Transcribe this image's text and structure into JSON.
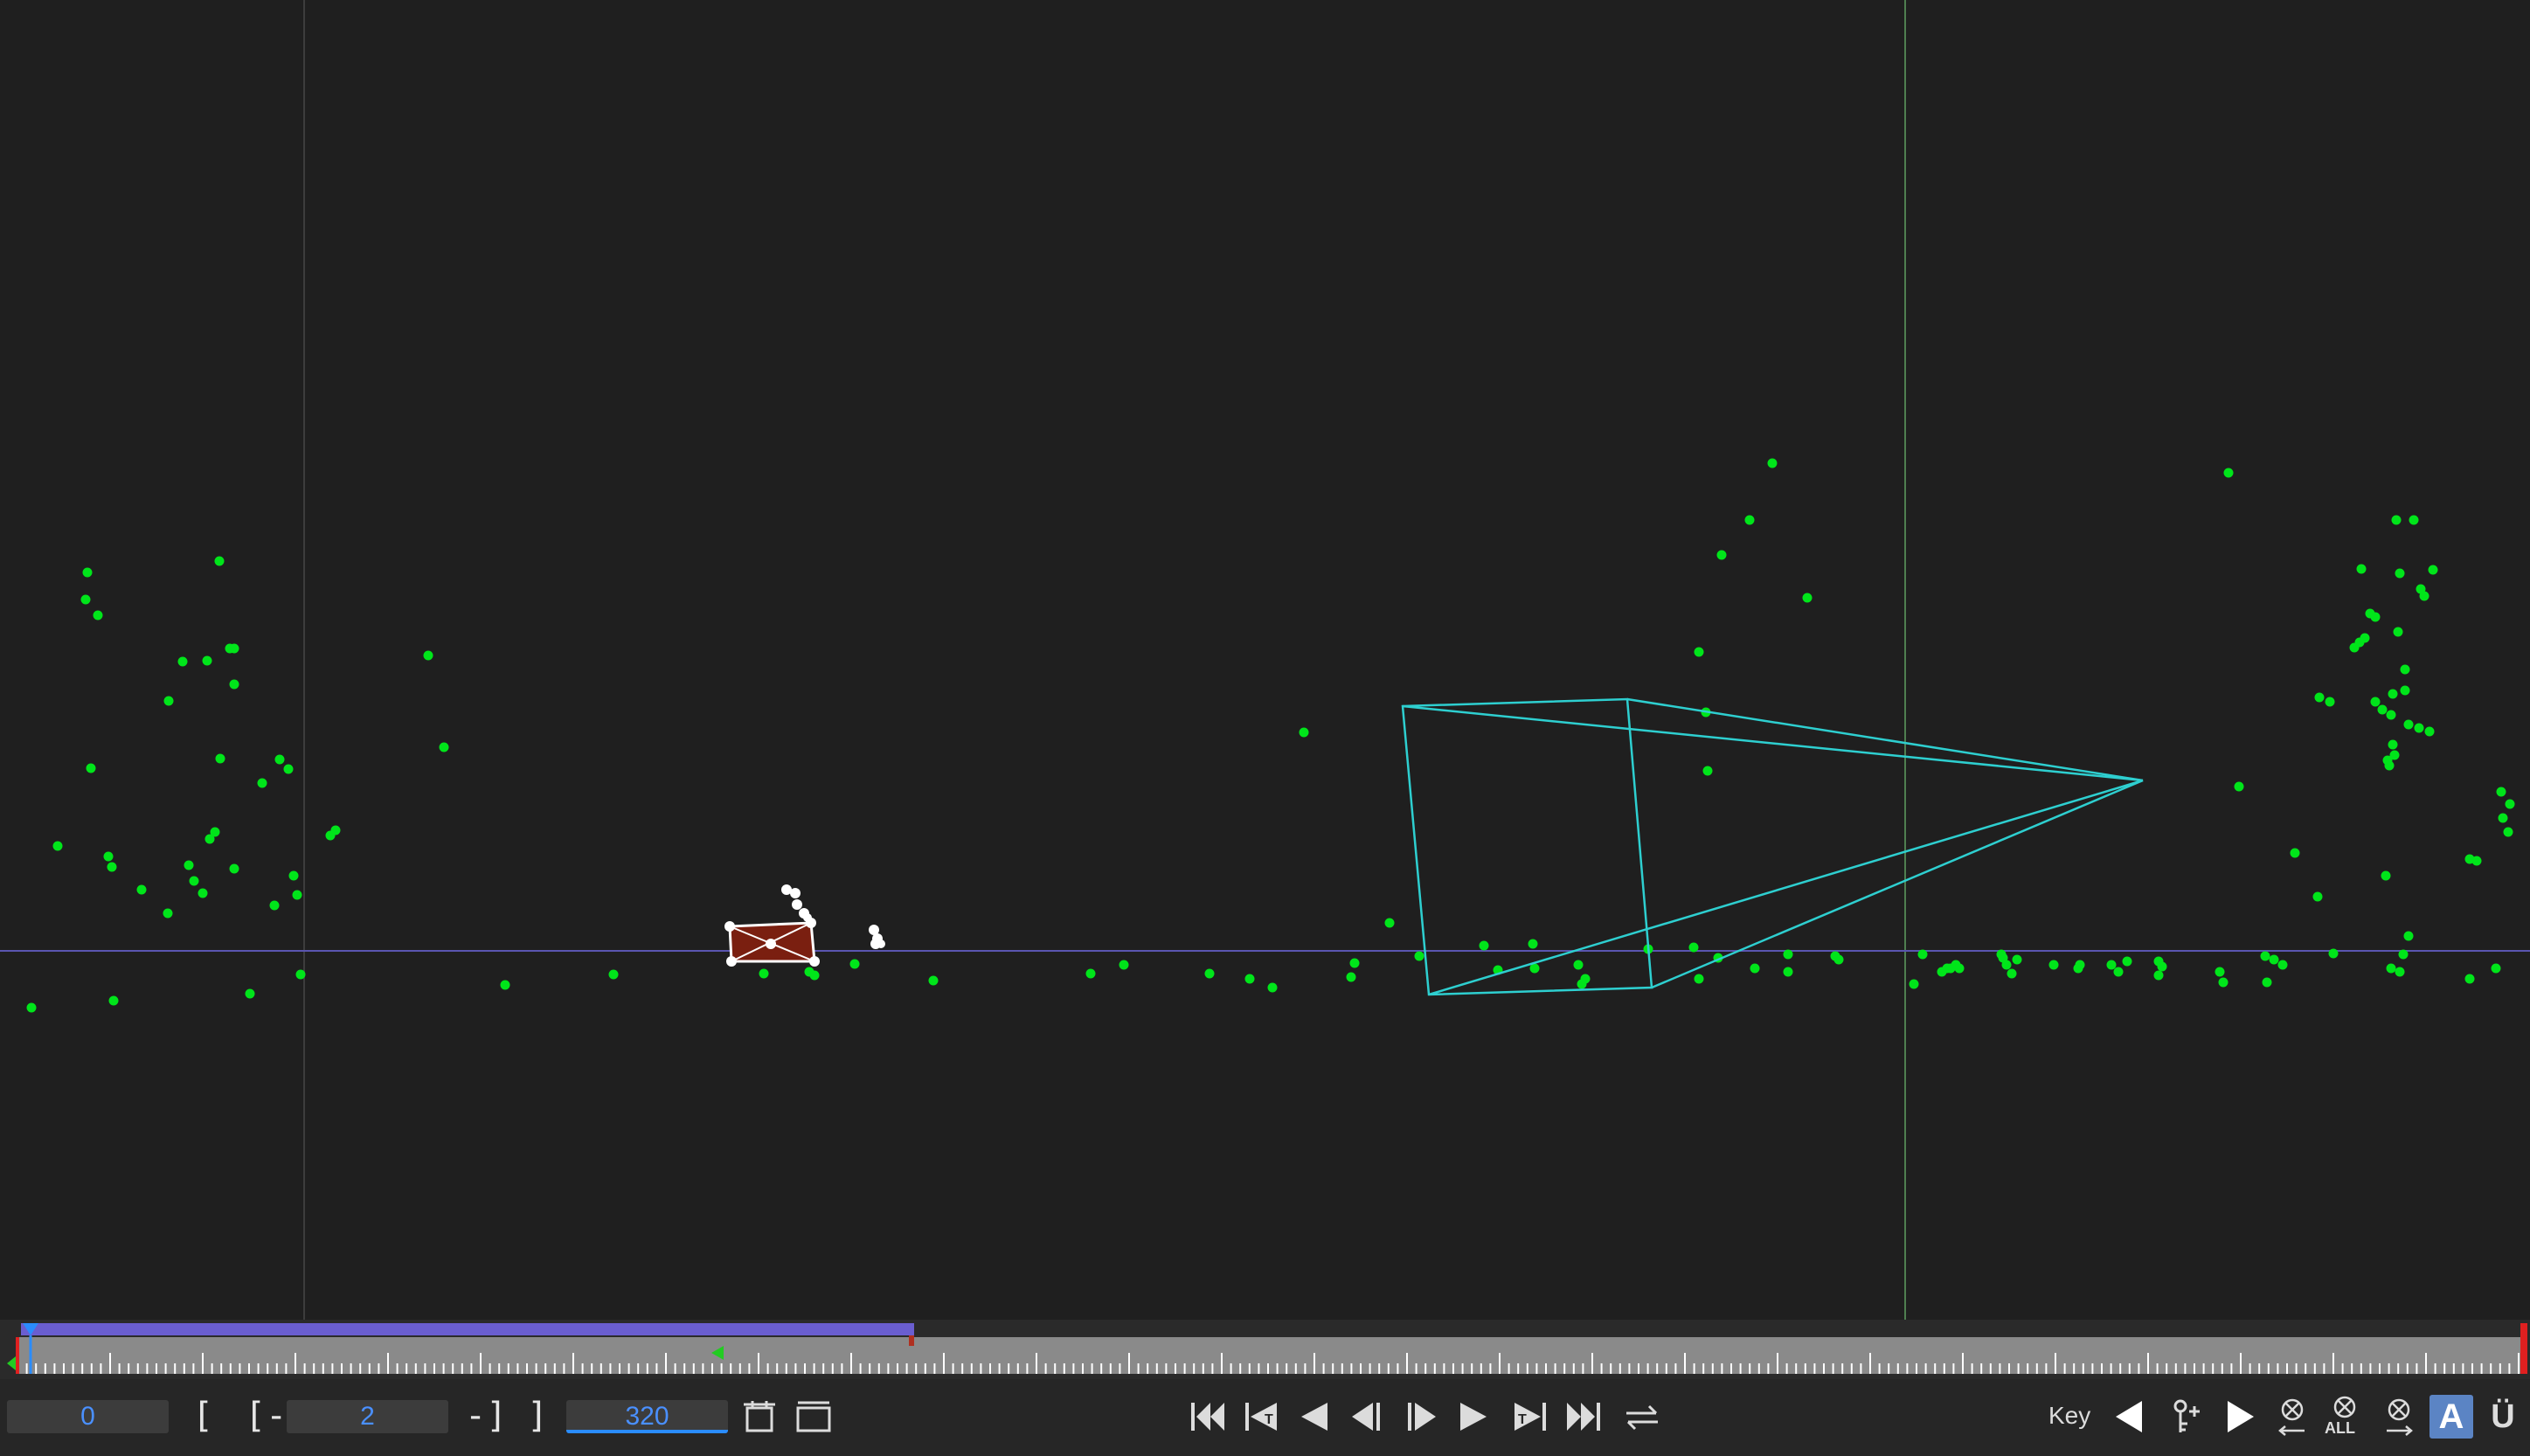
{
  "viewport": {
    "background": "#1f1f1f",
    "point_color": "#00e51a",
    "camera_color": "#2ecfd0",
    "ground_line_color": "#5a55b0",
    "selected_object_color": "#7a1f10"
  },
  "timeline": {
    "range_bar_color": "#6a5ed0",
    "current_frame_marker_color": "#2a8cff"
  },
  "controls": {
    "start_frame": "0",
    "start_bracket": "[",
    "in_bracket": "[-",
    "current_frame": "2",
    "out_bracket": "-]",
    "end_bracket": "]",
    "end_frame": "320",
    "key_label": "Key",
    "all_label": "ALL",
    "auto_key_label": "A",
    "last_label": "Ü",
    "icons": [
      "fit-range-icon",
      "full-range-icon",
      "go-to-start-icon",
      "prev-keyframe-icon",
      "play-backward-icon",
      "step-backward-icon",
      "step-forward-icon",
      "play-forward-icon",
      "next-keyframe-icon",
      "go-to-end-icon",
      "loop-icon",
      "prev-key-icon",
      "add-key-icon",
      "next-key-icon",
      "delete-key-left-icon",
      "delete-all-keys-icon",
      "delete-key-right-icon"
    ]
  }
}
